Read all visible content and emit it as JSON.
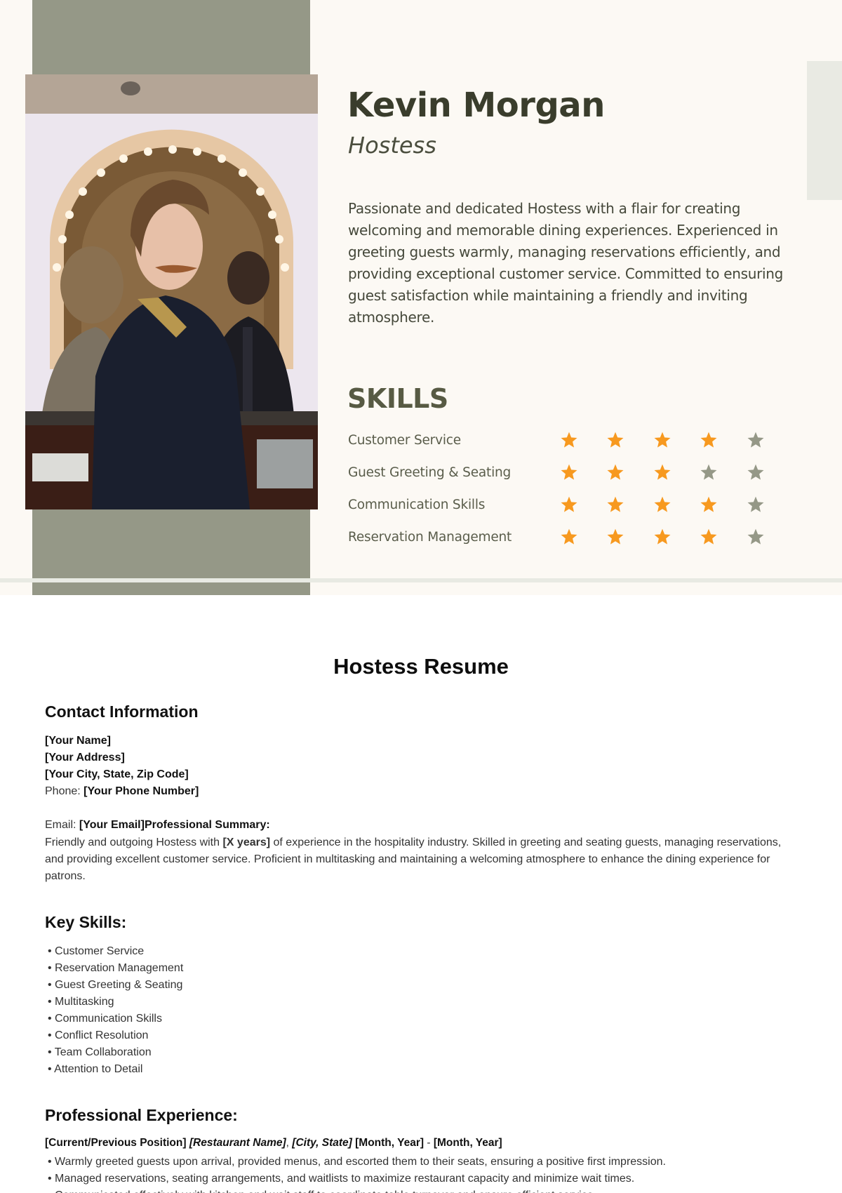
{
  "profile": {
    "name": "Kevin Morgan",
    "role": "Hostess",
    "summary": "Passionate and dedicated Hostess with a flair for creating welcoming and memorable dining experiences. Experienced in greeting guests warmly, managing reservations efficiently, and providing exceptional customer service. Committed to ensuring guest satisfaction while maintaining a friendly and inviting atmosphere.",
    "photo_alt": "Portrait of a man with a mustache in a dark jacket at a restaurant host stand"
  },
  "skills": {
    "title": "SKILLS",
    "max_rating": 5,
    "items": [
      {
        "label": "Customer Service",
        "rating": 4
      },
      {
        "label": "Guest Greeting & Seating",
        "rating": 3
      },
      {
        "label": "Communication Skills",
        "rating": 4
      },
      {
        "label": "Reservation Management",
        "rating": 4
      }
    ]
  },
  "colors": {
    "background": "#fcf9f4",
    "sage": "#959887",
    "heading": "#3a3d2c",
    "star_filled": "#f7991f",
    "star_empty": "#959887"
  },
  "document": {
    "title": "Hostess Resume",
    "contact": {
      "heading": "Contact Information",
      "name": "[Your Name]",
      "address": "[Your Address]",
      "city": "[Your City, State, Zip Code]",
      "phone_label": "Phone:",
      "phone": "[Your Phone Number]",
      "email_label": "Email:",
      "email": "[Your Email]"
    },
    "summary": {
      "heading": "Professional Summary:",
      "text_before": "Friendly and outgoing Hostess with ",
      "years": "[X years]",
      "text_after": " of experience in the hospitality industry. Skilled in greeting and seating guests, managing reservations, and providing excellent customer service. Proficient in multitasking and maintaining a welcoming atmosphere to enhance the dining experience for patrons."
    },
    "key_skills": {
      "heading": "Key Skills:",
      "items": [
        "Customer Service",
        "Reservation Management",
        "Guest Greeting & Seating",
        "Multitasking",
        "Communication Skills",
        "Conflict Resolution",
        "Team Collaboration",
        "Attention to Detail"
      ]
    },
    "experience": {
      "heading": "Professional Experience:",
      "position": "[Current/Previous Position]",
      "restaurant": "[Restaurant Name]",
      "sep": ",",
      "location": "[City, State]",
      "start": "[Month, Year]",
      "dash": "-",
      "end": "[Month, Year]",
      "bullets": [
        "Warmly greeted guests upon arrival, provided menus, and escorted them to their seats, ensuring a positive first impression.",
        "Managed reservations, seating arrangements, and waitlists to maximize restaurant capacity and minimize wait times.",
        "Communicated effectively with kitchen and wait staff to coordinate table turnover and ensure efficient service."
      ]
    }
  }
}
